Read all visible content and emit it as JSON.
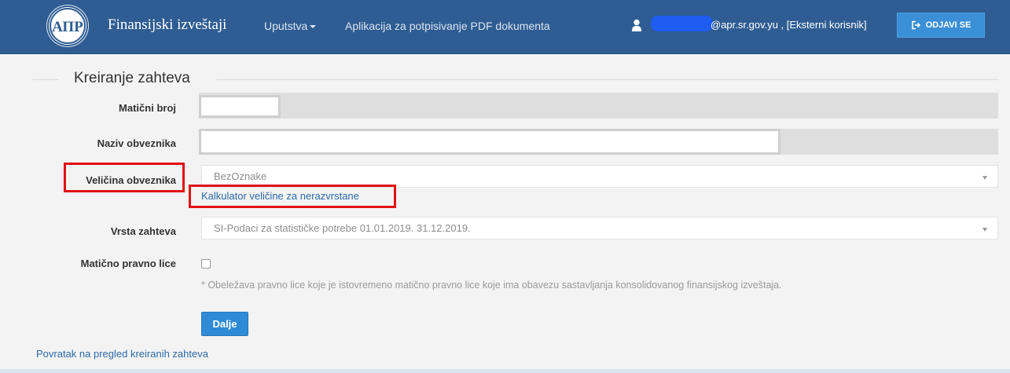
{
  "header": {
    "brand": "Finansijski izveštaji",
    "nav": {
      "uputstva": "Uputstva",
      "pdf_app": "Aplikacija za potpisivanje PDF dokumenta"
    },
    "user_text": "@apr.sr.gov.yu , [Eksterni korisnik]",
    "logout_label": "ODJAVI SE",
    "logo_text": "АПР"
  },
  "form": {
    "title": "Kreiranje zahteva",
    "labels": {
      "maticni_broj": "Matični broj",
      "naziv": "Naziv obveznika",
      "velicina": "Veličina obveznika",
      "vrsta": "Vrsta zahteva",
      "maticno_pravno_lice": "Matično pravno lice"
    },
    "velicina_value": "BezOznake",
    "calculator_link": "Kalkulator veličine za nerazvrstane",
    "vrsta_value": "SI-Podaci za statističke potrebe 01.01.2019. 31.12.2019.",
    "note": "* Obeležava pravno lice koje je istovremeno matično pravno lice koje ima obavezu sastavljanja konsolidovanog finansijskog izveštaja.",
    "submit_label": "Dalje",
    "back_link": "Povratak na pregled kreiranih zahteva"
  },
  "colors": {
    "navbar": "#2f5d93",
    "logout_button": "#3a8fd6",
    "highlight": "#e11111",
    "link": "#2b6aa8"
  }
}
